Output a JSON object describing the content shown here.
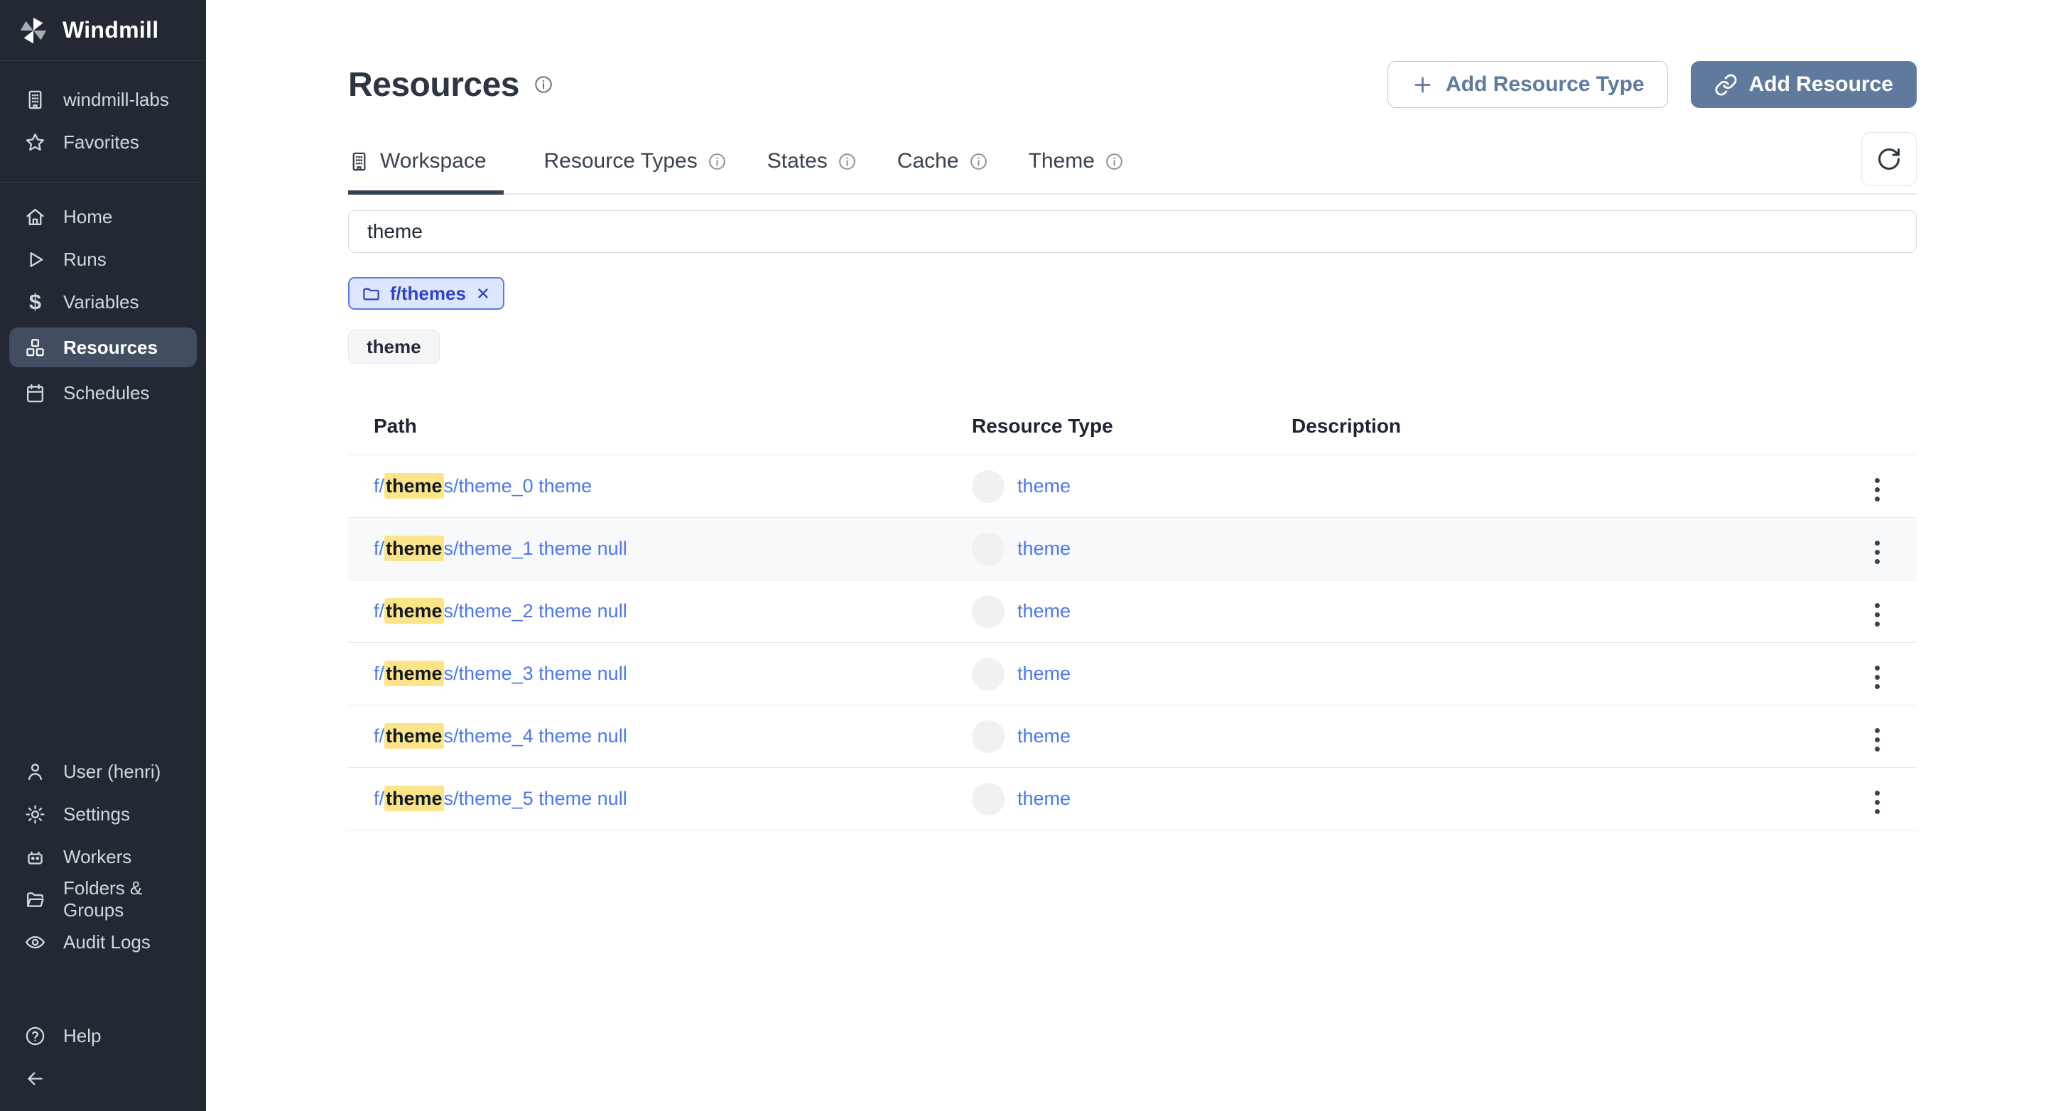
{
  "app": {
    "title": "Windmill"
  },
  "sidebar": {
    "workspace_label": "windmill-labs",
    "favorites_label": "Favorites",
    "nav": [
      {
        "label": "Home",
        "icon": "home-icon",
        "active": false
      },
      {
        "label": "Runs",
        "icon": "play-icon",
        "active": false
      },
      {
        "label": "Variables",
        "icon": "dollar-icon",
        "active": false
      },
      {
        "label": "Resources",
        "icon": "cubes-icon",
        "active": true
      },
      {
        "label": "Schedules",
        "icon": "calendar-icon",
        "active": false
      }
    ],
    "bottom": [
      {
        "label": "User (henri)",
        "icon": "user-icon"
      },
      {
        "label": "Settings",
        "icon": "gear-icon"
      },
      {
        "label": "Workers",
        "icon": "robot-icon"
      },
      {
        "label": "Folders & Groups",
        "icon": "folder-open-icon"
      },
      {
        "label": "Audit Logs",
        "icon": "eye-icon"
      }
    ],
    "help_label": "Help"
  },
  "header": {
    "title": "Resources",
    "add_resource_type_label": "Add Resource Type",
    "add_resource_label": "Add Resource"
  },
  "tabs": [
    {
      "label": "Workspace",
      "active": true,
      "icon": "building-icon"
    },
    {
      "label": "Resource Types",
      "info": true
    },
    {
      "label": "States",
      "info": true
    },
    {
      "label": "Cache",
      "info": true
    },
    {
      "label": "Theme",
      "info": true
    }
  ],
  "search": {
    "value": "theme"
  },
  "filters": {
    "folder_chip_label": "f/themes",
    "search_badge_label": "theme"
  },
  "table": {
    "columns": [
      "Path",
      "Resource Type",
      "Description"
    ],
    "rows": [
      {
        "path_prefix": "f/",
        "path_match": "theme",
        "path_suffix": "s/theme_0 theme",
        "resource_type": "theme",
        "description": "",
        "highlighted": false
      },
      {
        "path_prefix": "f/",
        "path_match": "theme",
        "path_suffix": "s/theme_1 theme null",
        "resource_type": "theme",
        "description": "",
        "highlighted": true
      },
      {
        "path_prefix": "f/",
        "path_match": "theme",
        "path_suffix": "s/theme_2 theme null",
        "resource_type": "theme",
        "description": "",
        "highlighted": false
      },
      {
        "path_prefix": "f/",
        "path_match": "theme",
        "path_suffix": "s/theme_3 theme null",
        "resource_type": "theme",
        "description": "",
        "highlighted": false
      },
      {
        "path_prefix": "f/",
        "path_match": "theme",
        "path_suffix": "s/theme_4 theme null",
        "resource_type": "theme",
        "description": "",
        "highlighted": false
      },
      {
        "path_prefix": "f/",
        "path_match": "theme",
        "path_suffix": "s/theme_5 theme null",
        "resource_type": "theme",
        "description": "",
        "highlighted": false
      }
    ]
  },
  "colors": {
    "sidebar_bg": "#232933",
    "sidebar_selected_bg": "#424d61",
    "primary_button": "#5f7a9c",
    "link_blue": "#4c78ee",
    "highlight_yellow": "#fce588",
    "chip_text": "#3142c4",
    "chip_bg": "#dde6fd"
  }
}
